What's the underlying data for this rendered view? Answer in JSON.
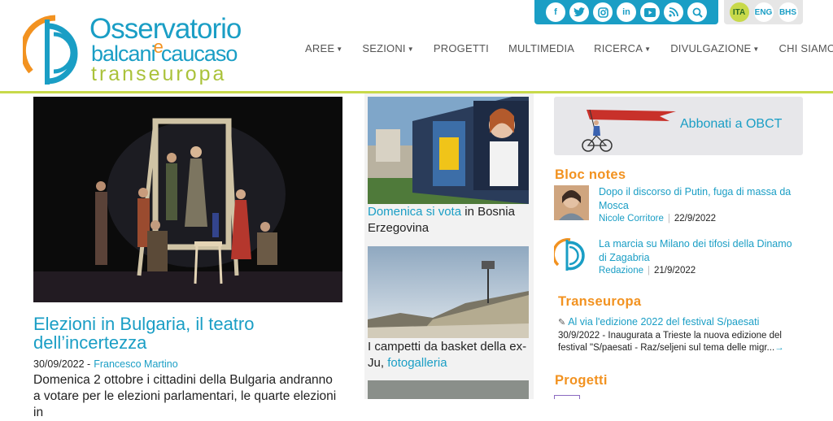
{
  "brand": {
    "line1": "Osservatorio",
    "line2a": "balcani",
    "line2e": "e",
    "line2b": "caucaso",
    "line3": "transeuropa"
  },
  "social_icons": [
    "facebook-icon",
    "twitter-icon",
    "instagram-icon",
    "linkedin-icon",
    "youtube-icon",
    "rss-icon",
    "search-icon"
  ],
  "languages": [
    {
      "code": "ITA",
      "active": true
    },
    {
      "code": "ENG",
      "active": false
    },
    {
      "code": "BHS",
      "active": false
    }
  ],
  "nav": {
    "items": [
      {
        "label": "AREE",
        "dropdown": true
      },
      {
        "label": "SEZIONI",
        "dropdown": true
      },
      {
        "label": "PROGETTI",
        "dropdown": false
      },
      {
        "label": "MULTIMEDIA",
        "dropdown": false
      },
      {
        "label": "RICERCA",
        "dropdown": true
      },
      {
        "label": "DIVULGAZIONE",
        "dropdown": true
      },
      {
        "label": "CHI SIAMO",
        "dropdown": true
      }
    ]
  },
  "lead": {
    "title": "Elezioni in Bulgaria, il teatro dell’incertezza",
    "date": "30/09/2022 -",
    "author": "Francesco Martino",
    "desc": "Domenica 2 ottobre i cittadini della Bulgaria andranno a votare per le elezioni parlamentari, le quarte elezioni in"
  },
  "middle": {
    "item1": {
      "link": "Domenica si vota",
      "rest": " in Bosnia Erzegovina"
    },
    "item2": {
      "text": "I campetti da basket della ex-Ju, ",
      "link": "fotogalleria"
    }
  },
  "promo": {
    "label": "Abbonati a OBCT"
  },
  "bloc_notes": {
    "title": "Bloc notes",
    "items": [
      {
        "title": "Dopo il discorso di Putin, fuga di massa da Mosca",
        "author": "Nicole Corritore",
        "date": "22/9/2022"
      },
      {
        "title": "La marcia su Milano dei tifosi della Dinamo di Zagabria",
        "author": "Redazione",
        "date": "21/9/2022"
      }
    ]
  },
  "transeuropa": {
    "title": "Transeuropa",
    "item": {
      "title": "Al via l'edizione 2022 del festival S/paesati",
      "desc": "30/9/2022 - Inaugurata a Trieste la nuova edizione del festival \"S/paesati - Raz/seljeni sul tema delle migr...",
      "more": "→"
    }
  },
  "progetti": {
    "title": "Progetti"
  },
  "colors": {
    "accent": "#1a9ec5",
    "orange": "#f29220",
    "green": "#c8d94a"
  }
}
